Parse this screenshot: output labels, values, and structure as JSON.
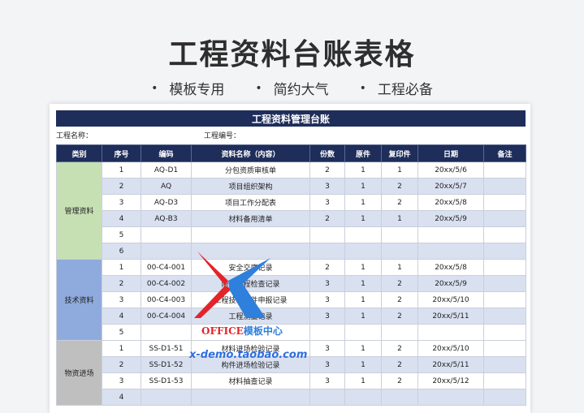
{
  "hero": {
    "title": "工程资料台账表格",
    "features": [
      "模板专用",
      "简约大气",
      "工程必备"
    ],
    "bullet": "•"
  },
  "sheet": {
    "title": "工程资料管理台账",
    "project_name_label": "工程名称：",
    "project_no_label": "工程编号：",
    "headers": [
      "类别",
      "序号",
      "编码",
      "资料名称（内容）",
      "份数",
      "原件",
      "复印件",
      "日期",
      "备注"
    ],
    "groups": [
      {
        "category": "管理资料",
        "color": "#c6e0b4",
        "rows": [
          {
            "seq": "1",
            "code": "AQ-D1",
            "name": "分包资质审核单",
            "copies": "2",
            "original": "1",
            "photocopy": "1",
            "date": "20xx/5/6",
            "note": ""
          },
          {
            "seq": "2",
            "code": "AQ",
            "name": "项目组织架构",
            "copies": "3",
            "original": "1",
            "photocopy": "2",
            "date": "20xx/5/7",
            "note": ""
          },
          {
            "seq": "3",
            "code": "AQ-D3",
            "name": "项目工作分配表",
            "copies": "3",
            "original": "1",
            "photocopy": "2",
            "date": "20xx/5/8",
            "note": ""
          },
          {
            "seq": "4",
            "code": "AQ-B3",
            "name": "材料备用清单",
            "copies": "2",
            "original": "1",
            "photocopy": "1",
            "date": "20xx/5/9",
            "note": ""
          },
          {
            "seq": "5",
            "code": "",
            "name": "",
            "copies": "",
            "original": "",
            "photocopy": "",
            "date": "",
            "note": ""
          },
          {
            "seq": "6",
            "code": "",
            "name": "",
            "copies": "",
            "original": "",
            "photocopy": "",
            "date": "",
            "note": ""
          }
        ]
      },
      {
        "category": "技术资料",
        "color": "#8faadc",
        "rows": [
          {
            "seq": "1",
            "code": "00-C4-001",
            "name": "安全交底记录",
            "copies": "2",
            "original": "1",
            "photocopy": "1",
            "date": "20xx/5/8",
            "note": ""
          },
          {
            "seq": "2",
            "code": "00-C4-002",
            "name": "隐蔽工程检查记录",
            "copies": "3",
            "original": "1",
            "photocopy": "2",
            "date": "20xx/5/9",
            "note": ""
          },
          {
            "seq": "3",
            "code": "00-C4-003",
            "name": "工程技术文件申报记录",
            "copies": "3",
            "original": "1",
            "photocopy": "2",
            "date": "20xx/5/10",
            "note": ""
          },
          {
            "seq": "4",
            "code": "00-C4-004",
            "name": "工程测量记录",
            "copies": "3",
            "original": "1",
            "photocopy": "2",
            "date": "20xx/5/11",
            "note": ""
          },
          {
            "seq": "5",
            "code": "",
            "name": "",
            "copies": "",
            "original": "",
            "photocopy": "",
            "date": "",
            "note": ""
          }
        ]
      },
      {
        "category": "物资进场",
        "color": "#bfbfbf",
        "rows": [
          {
            "seq": "1",
            "code": "SS-D1-51",
            "name": "材料进场检验记录",
            "copies": "3",
            "original": "1",
            "photocopy": "2",
            "date": "20xx/5/10",
            "note": ""
          },
          {
            "seq": "2",
            "code": "SS-D1-52",
            "name": "构件进场检验记录",
            "copies": "3",
            "original": "1",
            "photocopy": "2",
            "date": "20xx/5/11",
            "note": ""
          },
          {
            "seq": "3",
            "code": "SS-D1-53",
            "name": "材料抽查记录",
            "copies": "3",
            "original": "1",
            "photocopy": "2",
            "date": "20xx/5/12",
            "note": ""
          },
          {
            "seq": "4",
            "code": "",
            "name": "",
            "copies": "",
            "original": "",
            "photocopy": "",
            "date": "",
            "note": ""
          }
        ]
      }
    ]
  },
  "watermark": {
    "brand_en": "OFFICE",
    "brand_zh": "模板中心",
    "url": "x-demo.taobao.com"
  }
}
